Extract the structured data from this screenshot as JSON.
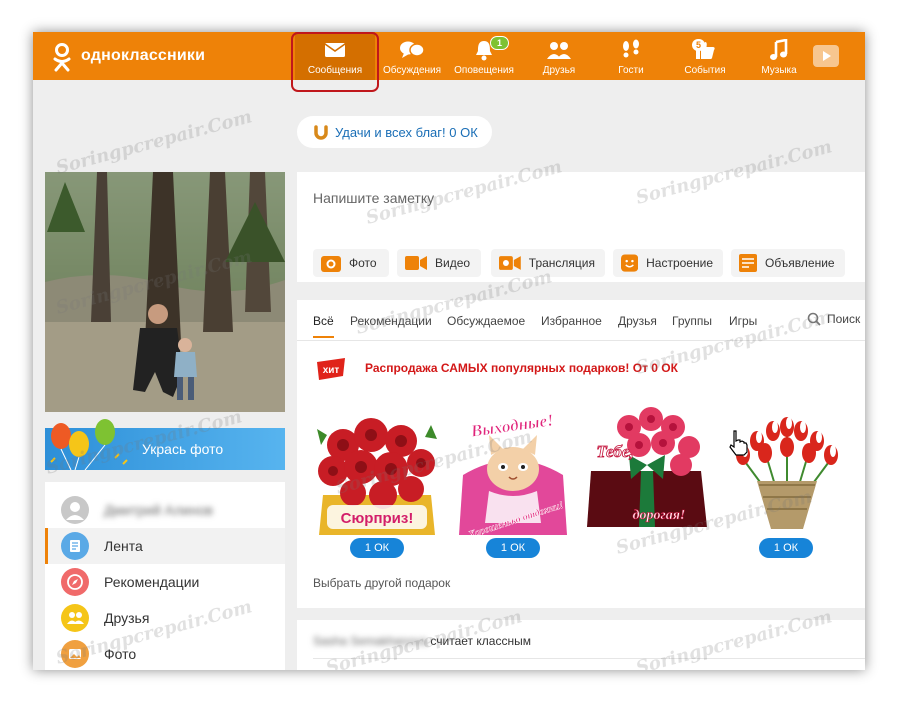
{
  "brand": {
    "name": "одноклассники"
  },
  "nav": {
    "items": [
      {
        "label": "Сообщения",
        "icon": "envelope-icon"
      },
      {
        "label": "Обсуждения",
        "icon": "chat-bubbles-icon"
      },
      {
        "label": "Оповещения",
        "icon": "bell-icon",
        "badge": "1"
      },
      {
        "label": "Друзья",
        "icon": "friends-icon"
      },
      {
        "label": "Гости",
        "icon": "footprints-icon"
      },
      {
        "label": "События",
        "icon": "thumbs-up-icon",
        "badge": "5"
      },
      {
        "label": "Музыка",
        "icon": "music-note-icon"
      }
    ]
  },
  "greeting": {
    "text": "Удачи и всех благ! 0 ОК"
  },
  "profile": {
    "decorate_label": "Укрась фото"
  },
  "menu": {
    "items": [
      {
        "label": "Дмитрий Алинов"
      },
      {
        "label": "Лента"
      },
      {
        "label": "Рекомендации"
      },
      {
        "label": "Друзья"
      },
      {
        "label": "Фото"
      }
    ]
  },
  "note": {
    "placeholder": "Напишите заметку",
    "actions": [
      {
        "label": "Фото"
      },
      {
        "label": "Видео"
      },
      {
        "label": "Трансляция"
      },
      {
        "label": "Настроение"
      },
      {
        "label": "Объявление"
      }
    ]
  },
  "feed": {
    "tabs": [
      "Всё",
      "Рекомендации",
      "Обсуждаемое",
      "Избранное",
      "Друзья",
      "Группы",
      "Игры"
    ],
    "search_label": "Поиск",
    "hit_badge": "хит",
    "sale_text": "Распродажа САМЫХ популярных подарков! От 0 ОК",
    "gifts": [
      {
        "caption": "Сюрприз!",
        "price": "1 ОК"
      },
      {
        "caption_top": "Выходные!",
        "caption_bottom": "Хорошенько отдохни!",
        "price": "1 ОК"
      },
      {
        "caption_top": "Тебе,",
        "caption_bottom": "дорогая!"
      },
      {
        "price": "1 ОК"
      }
    ],
    "choose_other": "Выбрать другой подарок"
  },
  "bottom_card": {
    "name": "Sasha Semakhanova",
    "action": "считает классным"
  },
  "watermark": "Soringpcrepair.Com",
  "colors": {
    "accent": "#ee8208",
    "highlight": "#c0171c",
    "link": "#1a6eb6",
    "price": "#1784d8",
    "sale": "#d31818"
  }
}
